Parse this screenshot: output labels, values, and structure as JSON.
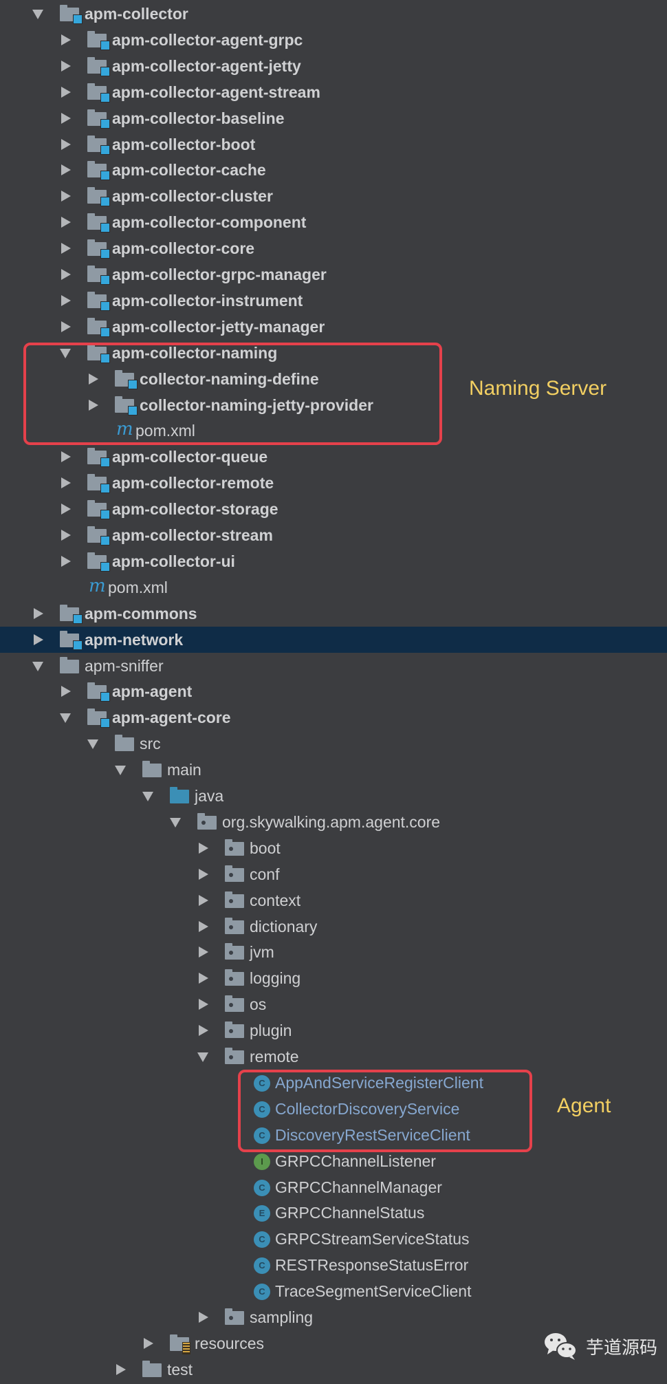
{
  "tree": [
    {
      "label": "apm-collector",
      "level": 0,
      "arrow": "expanded",
      "icon": "module",
      "bold": true
    },
    {
      "label": "apm-collector-agent-grpc",
      "level": 1,
      "arrow": "collapsed",
      "icon": "module",
      "bold": true
    },
    {
      "label": "apm-collector-agent-jetty",
      "level": 1,
      "arrow": "collapsed",
      "icon": "module",
      "bold": true
    },
    {
      "label": "apm-collector-agent-stream",
      "level": 1,
      "arrow": "collapsed",
      "icon": "module",
      "bold": true
    },
    {
      "label": "apm-collector-baseline",
      "level": 1,
      "arrow": "collapsed",
      "icon": "module",
      "bold": true
    },
    {
      "label": "apm-collector-boot",
      "level": 1,
      "arrow": "collapsed",
      "icon": "module",
      "bold": true
    },
    {
      "label": "apm-collector-cache",
      "level": 1,
      "arrow": "collapsed",
      "icon": "module",
      "bold": true
    },
    {
      "label": "apm-collector-cluster",
      "level": 1,
      "arrow": "collapsed",
      "icon": "module",
      "bold": true
    },
    {
      "label": "apm-collector-component",
      "level": 1,
      "arrow": "collapsed",
      "icon": "module",
      "bold": true
    },
    {
      "label": "apm-collector-core",
      "level": 1,
      "arrow": "collapsed",
      "icon": "module",
      "bold": true
    },
    {
      "label": "apm-collector-grpc-manager",
      "level": 1,
      "arrow": "collapsed",
      "icon": "module",
      "bold": true
    },
    {
      "label": "apm-collector-instrument",
      "level": 1,
      "arrow": "collapsed",
      "icon": "module",
      "bold": true
    },
    {
      "label": "apm-collector-jetty-manager",
      "level": 1,
      "arrow": "collapsed",
      "icon": "module",
      "bold": true
    },
    {
      "label": "apm-collector-naming",
      "level": 1,
      "arrow": "expanded",
      "icon": "module",
      "bold": true
    },
    {
      "label": "collector-naming-define",
      "level": 2,
      "arrow": "collapsed",
      "icon": "module",
      "bold": true
    },
    {
      "label": "collector-naming-jetty-provider",
      "level": 2,
      "arrow": "collapsed",
      "icon": "module",
      "bold": true
    },
    {
      "label": "pom.xml",
      "level": 2,
      "arrow": "none",
      "icon": "maven",
      "bold": false
    },
    {
      "label": "apm-collector-queue",
      "level": 1,
      "arrow": "collapsed",
      "icon": "module",
      "bold": true
    },
    {
      "label": "apm-collector-remote",
      "level": 1,
      "arrow": "collapsed",
      "icon": "module",
      "bold": true
    },
    {
      "label": "apm-collector-storage",
      "level": 1,
      "arrow": "collapsed",
      "icon": "module",
      "bold": true
    },
    {
      "label": "apm-collector-stream",
      "level": 1,
      "arrow": "collapsed",
      "icon": "module",
      "bold": true
    },
    {
      "label": "apm-collector-ui",
      "level": 1,
      "arrow": "collapsed",
      "icon": "module",
      "bold": true
    },
    {
      "label": "pom.xml",
      "level": 1,
      "arrow": "none",
      "icon": "maven",
      "bold": false
    },
    {
      "label": "apm-commons",
      "level": 0,
      "arrow": "collapsed",
      "icon": "module",
      "bold": true
    },
    {
      "label": "apm-network",
      "level": 0,
      "arrow": "collapsed",
      "icon": "module",
      "bold": true,
      "selected": true
    },
    {
      "label": "apm-sniffer",
      "level": 0,
      "arrow": "expanded",
      "icon": "folder",
      "bold": false
    },
    {
      "label": "apm-agent",
      "level": 1,
      "arrow": "collapsed",
      "icon": "module",
      "bold": true
    },
    {
      "label": "apm-agent-core",
      "level": 1,
      "arrow": "expanded",
      "icon": "module",
      "bold": true
    },
    {
      "label": "src",
      "level": 2,
      "arrow": "expanded",
      "icon": "folder",
      "bold": false
    },
    {
      "label": "main",
      "level": 3,
      "arrow": "expanded",
      "icon": "folder",
      "bold": false
    },
    {
      "label": "java",
      "level": 4,
      "arrow": "expanded",
      "icon": "source-folder",
      "bold": false
    },
    {
      "label": "org.skywalking.apm.agent.core",
      "level": 5,
      "arrow": "expanded",
      "icon": "package",
      "bold": false
    },
    {
      "label": "boot",
      "level": 6,
      "arrow": "collapsed",
      "icon": "package",
      "bold": false
    },
    {
      "label": "conf",
      "level": 6,
      "arrow": "collapsed",
      "icon": "package",
      "bold": false
    },
    {
      "label": "context",
      "level": 6,
      "arrow": "collapsed",
      "icon": "package",
      "bold": false
    },
    {
      "label": "dictionary",
      "level": 6,
      "arrow": "collapsed",
      "icon": "package",
      "bold": false
    },
    {
      "label": "jvm",
      "level": 6,
      "arrow": "collapsed",
      "icon": "package",
      "bold": false
    },
    {
      "label": "logging",
      "level": 6,
      "arrow": "collapsed",
      "icon": "package",
      "bold": false
    },
    {
      "label": "os",
      "level": 6,
      "arrow": "collapsed",
      "icon": "package",
      "bold": false
    },
    {
      "label": "plugin",
      "level": 6,
      "arrow": "collapsed",
      "icon": "package",
      "bold": false
    },
    {
      "label": "remote",
      "level": 6,
      "arrow": "expanded",
      "icon": "package",
      "bold": false
    },
    {
      "label": "AppAndServiceRegisterClient",
      "level": 7,
      "arrow": "none",
      "icon": "class",
      "badge": "C",
      "bold": false,
      "highlight": true
    },
    {
      "label": "CollectorDiscoveryService",
      "level": 7,
      "arrow": "none",
      "icon": "class",
      "badge": "C",
      "bold": false,
      "highlight": true
    },
    {
      "label": "DiscoveryRestServiceClient",
      "level": 7,
      "arrow": "none",
      "icon": "class",
      "badge": "C",
      "bold": false,
      "highlight": true
    },
    {
      "label": "GRPCChannelListener",
      "level": 7,
      "arrow": "none",
      "icon": "interface",
      "badge": "I",
      "bold": false
    },
    {
      "label": "GRPCChannelManager",
      "level": 7,
      "arrow": "none",
      "icon": "class",
      "badge": "C",
      "bold": false
    },
    {
      "label": "GRPCChannelStatus",
      "level": 7,
      "arrow": "none",
      "icon": "enum",
      "badge": "E",
      "bold": false
    },
    {
      "label": "GRPCStreamServiceStatus",
      "level": 7,
      "arrow": "none",
      "icon": "class",
      "badge": "C",
      "bold": false
    },
    {
      "label": "RESTResponseStatusError",
      "level": 7,
      "arrow": "none",
      "icon": "class",
      "badge": "C",
      "bold": false
    },
    {
      "label": "TraceSegmentServiceClient",
      "level": 7,
      "arrow": "none",
      "icon": "class",
      "badge": "C",
      "bold": false
    },
    {
      "label": "sampling",
      "level": 6,
      "arrow": "collapsed",
      "icon": "package",
      "bold": false
    },
    {
      "label": "resources",
      "level": 4,
      "arrow": "collapsed",
      "icon": "resources-folder",
      "bold": false
    },
    {
      "label": "test",
      "level": 3,
      "arrow": "collapsed",
      "icon": "folder",
      "bold": false
    }
  ],
  "annotations": {
    "naming": "Naming Server",
    "agent": "Agent"
  },
  "watermark": {
    "icon": "wechat-icon",
    "text": "芋道源码"
  },
  "colors": {
    "background": "#3c3d40",
    "selection": "#0f2c47",
    "callout_border": "#e5414b",
    "annotation_text": "#f2cf62",
    "highlight_text": "#86a7cf",
    "module_badge": "#35a7dc"
  }
}
